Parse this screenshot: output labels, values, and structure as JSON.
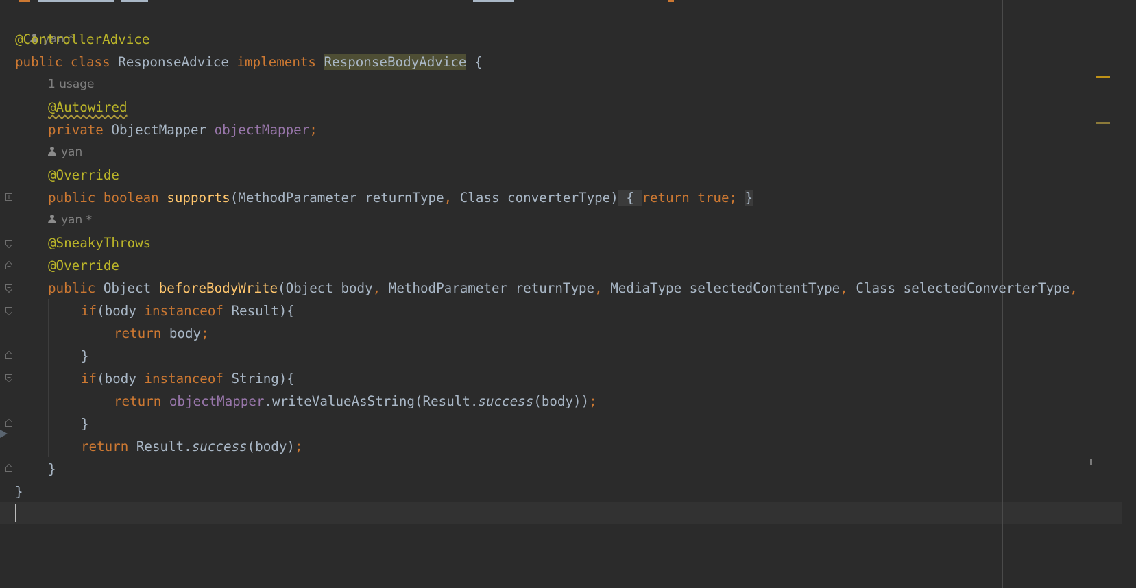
{
  "author_hints": {
    "class_author": "yan *",
    "usage_count": "1 usage",
    "supports_author": "yan",
    "before_author": "yan *"
  },
  "code": {
    "l1": "@ControllerAdvice",
    "l2_public": "public ",
    "l2_class": "class ",
    "l2_name": "ResponseAdvice ",
    "l2_impl": "implements ",
    "l2_iface": "ResponseBodyAdvice",
    "l2_brace": " {",
    "l3": "@Autowired",
    "l4_private": "private ",
    "l4_type": "ObjectMapper ",
    "l4_field": "objectMapper",
    "l4_semi": ";",
    "l5": "@Override",
    "l6_public": "public ",
    "l6_boolean": "boolean ",
    "l6_fn": "supports",
    "l6_params1": "(MethodParameter returnType",
    "l6_comma": ", ",
    "l6_params2": "Class converterType)",
    "l6_open": " { ",
    "l6_return": "return ",
    "l6_true": "true",
    "l6_semi": "; ",
    "l6_close": "}",
    "l7": "@SneakyThrows",
    "l8": "@Override",
    "l9_public": "public ",
    "l9_type": "Object ",
    "l9_fn": "beforeBodyWrite",
    "l9_p1": "(Object body",
    "l9_c1": ", ",
    "l9_p2": "MethodParameter returnType",
    "l9_c2": ", ",
    "l9_p3": "MediaType selectedContentType",
    "l9_c3": ", ",
    "l9_p4": "Class selectedConverterType",
    "l9_c4": ",",
    "l10_if": "if",
    "l10_a": "(body ",
    "l10_inst": "instanceof ",
    "l10_b": "Result){",
    "l11_return": "return ",
    "l11_body": "body",
    "l11_semi": ";",
    "l12": "}",
    "l13_if": "if",
    "l13_a": "(body ",
    "l13_inst": "instanceof ",
    "l13_b": "String){",
    "l14_return": "return ",
    "l14_field": "objectMapper",
    "l14_a": ".writeValueAsString(Result.",
    "l14_success": "success",
    "l14_b": "(body))",
    "l14_semi": ";",
    "l15": "}",
    "l16_return": "return ",
    "l16_a": "Result.",
    "l16_success": "success",
    "l16_b": "(body)",
    "l16_semi": ";",
    "l17": "}",
    "l18": "}"
  },
  "colors": {
    "background": "#2b2b2b",
    "keyword": "#cc7832",
    "annotation": "#bbb529",
    "method": "#ffc66d",
    "field": "#9876aa",
    "text": "#a9b7c6"
  }
}
